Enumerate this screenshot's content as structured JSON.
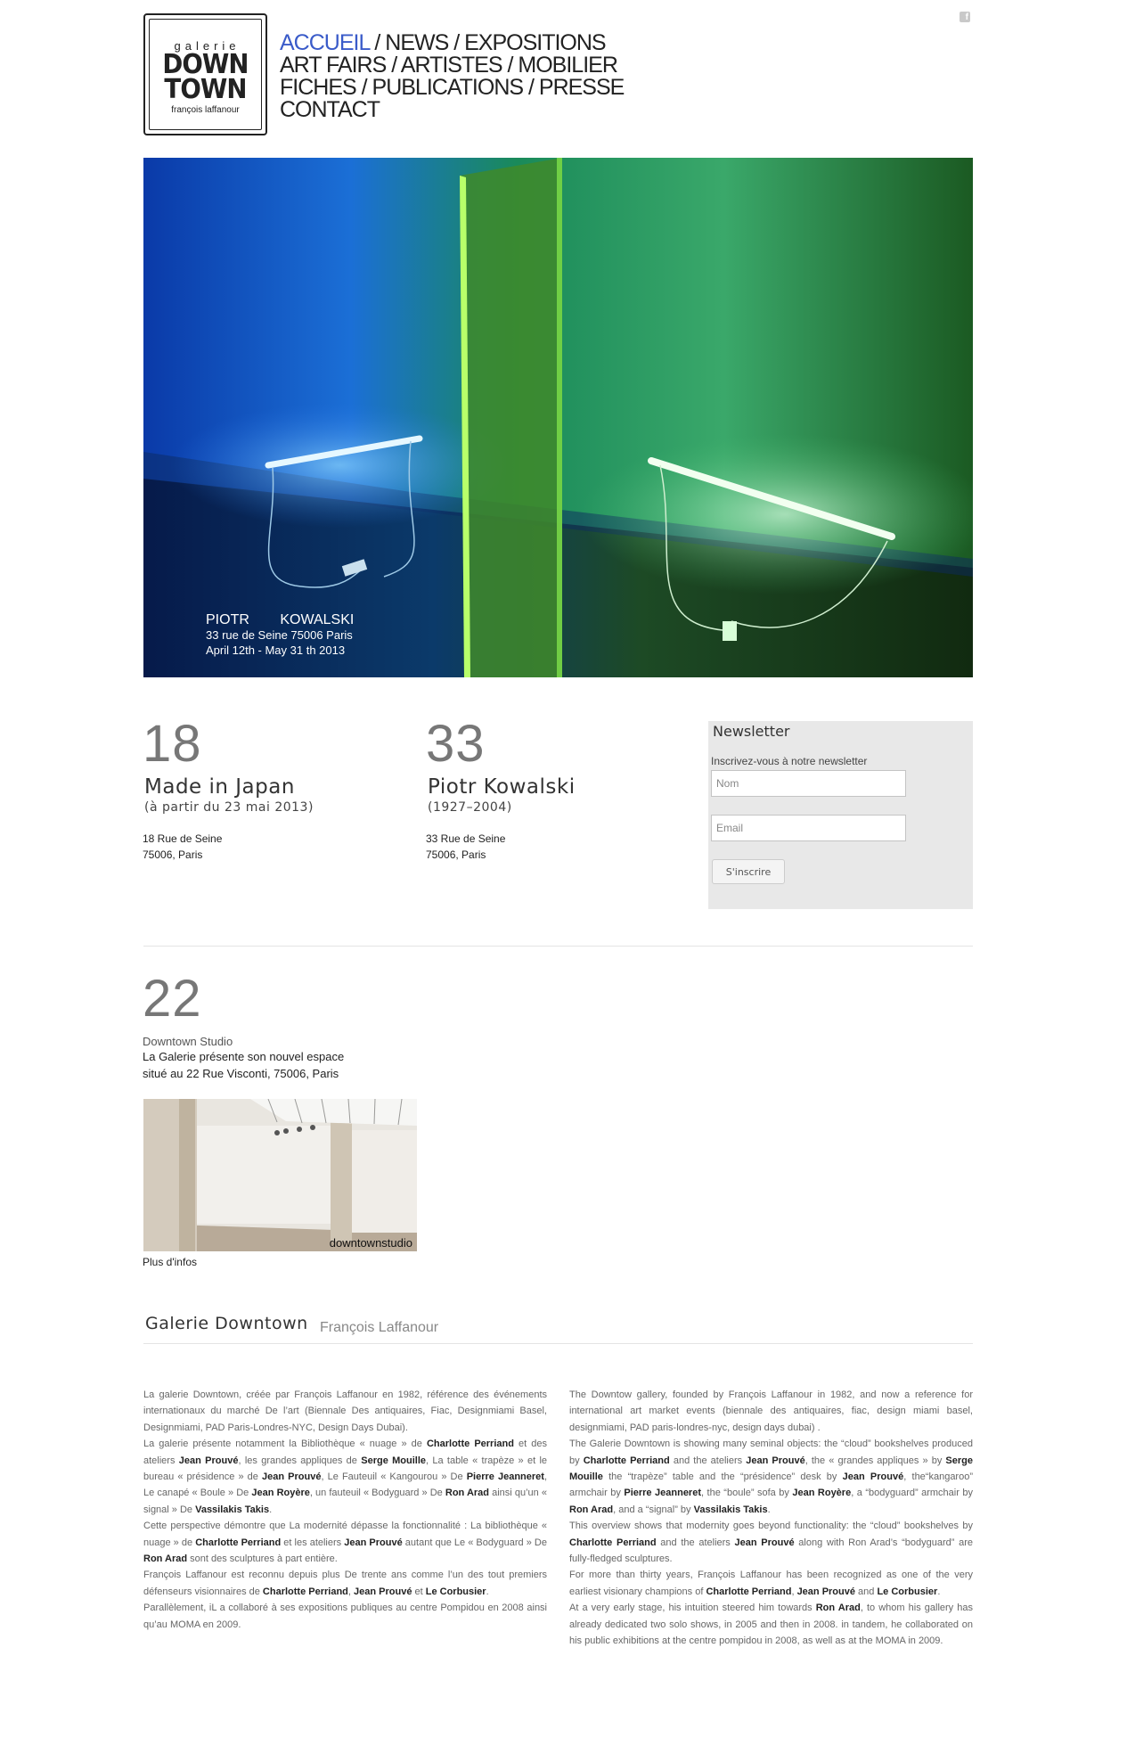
{
  "logo": {
    "line1": "galerie",
    "line2": "DOWN",
    "line3": "TOWN",
    "line4": "françois laffanour"
  },
  "nav": {
    "items": [
      "ACCUEIL",
      "NEWS",
      "EXPOSITIONS",
      "ART FAIRS",
      "ARTISTES",
      "MOBILIER",
      "FICHES",
      "PUBLICATIONS",
      "PRESSE",
      "CONTACT"
    ],
    "separator": " / ",
    "active": "ACCUEIL"
  },
  "social": {
    "facebook_icon": "facebook-icon",
    "glyph": "f"
  },
  "hero": {
    "artist": "PIOTR KOWALSKI",
    "address": "33 rue de Seine 75006 Paris",
    "dates": "April 12th - May 31 th 2013"
  },
  "venues": [
    {
      "number": "18",
      "title": "Made in Japan",
      "subtitle": "(à partir du 23 mai 2013)",
      "addr1": "18 Rue de Seine",
      "addr2": "75006, Paris"
    },
    {
      "number": "33",
      "title": "Piotr Kowalski",
      "subtitle": "(1927–2004)",
      "addr1": "33 Rue de Seine",
      "addr2": "75006, Paris"
    }
  ],
  "newsletter": {
    "title": "Newsletter",
    "description": "Inscrivez-vous à notre newsletter",
    "name_placeholder": "Nom",
    "email_placeholder": "Email",
    "submit": "S'inscrire"
  },
  "studio": {
    "number": "22",
    "name": "Downtown Studio",
    "line1": "La Galerie présente son nouvel espace",
    "line2": "situé au 22 Rue Visconti, 75006, Paris",
    "image_watermark": "downtownstudio",
    "more": "Plus d'infos"
  },
  "about": {
    "title": "Galerie Downtown",
    "subtitle": "François Laffanour"
  },
  "colors": {
    "accent": "#3a5bc9",
    "panel": "#e8e8e8"
  }
}
